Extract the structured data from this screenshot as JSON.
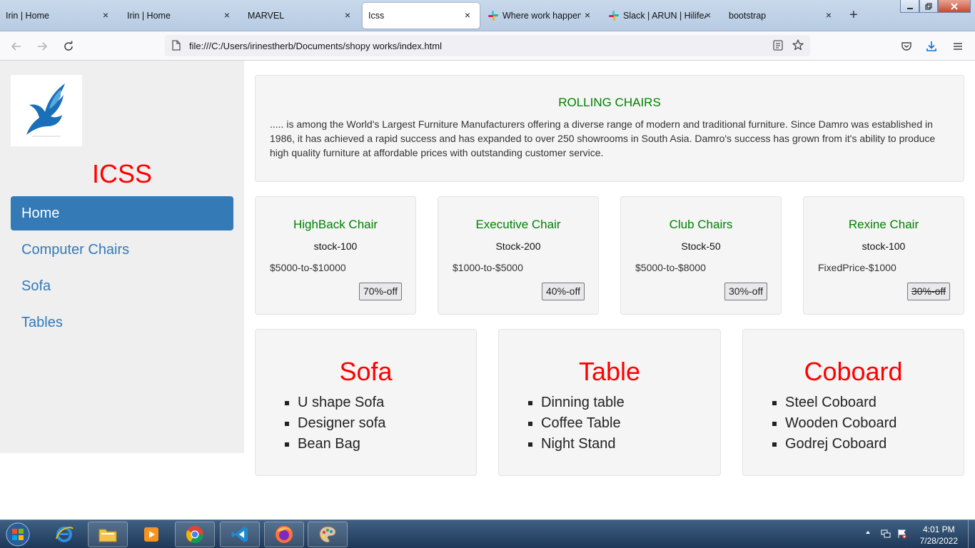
{
  "browser": {
    "tabs": [
      {
        "label": "Irin | Home",
        "active": false,
        "icon": "page-icon"
      },
      {
        "label": "Irin | Home",
        "active": false,
        "icon": "page-icon"
      },
      {
        "label": "MARVEL",
        "active": false,
        "icon": "page-icon"
      },
      {
        "label": "Icss",
        "active": true,
        "icon": "page-icon"
      },
      {
        "label": "Where work happens",
        "active": false,
        "icon": "slack-icon"
      },
      {
        "label": "Slack | ARUN | HilifeA",
        "active": false,
        "icon": "slack-icon"
      },
      {
        "label": "bootstrap",
        "active": false,
        "icon": "page-icon"
      }
    ],
    "tab_close_glyph": "×",
    "new_tab_glyph": "+",
    "url": "file:///C:/Users/irinestherb/Documents/shopy works/index.html"
  },
  "sidebar": {
    "brand": "ICSS",
    "menu": [
      {
        "label": "Home",
        "active": true
      },
      {
        "label": "Computer Chairs",
        "active": false
      },
      {
        "label": "Sofa",
        "active": false
      },
      {
        "label": "Tables",
        "active": false
      }
    ]
  },
  "hero": {
    "title": "ROLLING CHAIRS",
    "text": "..... is among the World's Largest Furniture Manufacturers offering a diverse range of modern and traditional furniture. Since Damro was established in 1986, it has achieved a rapid success and has expanded to over 250 showrooms in South Asia. Damro's success has grown from it's ability to produce high quality furniture at affordable prices with outstanding customer service."
  },
  "products": [
    {
      "name": "HighBack Chair",
      "stock": "stock-100",
      "price": "$5000-to-$10000",
      "discount": "70%-off",
      "struck": false
    },
    {
      "name": "Executive Chair",
      "stock": "Stock-200",
      "price": "$1000-to-$5000",
      "discount": "40%-off",
      "struck": false
    },
    {
      "name": "Club Chairs",
      "stock": "Stock-50",
      "price": "$5000-to-$8000",
      "discount": "30%-off",
      "struck": false
    },
    {
      "name": "Rexine Chair",
      "stock": "stock-100",
      "price": "FixedPrice-$1000",
      "discount": "30%-off",
      "struck": true
    }
  ],
  "categories": [
    {
      "title": "Sofa",
      "items": [
        "U shape Sofa",
        "Designer sofa",
        "Bean Bag"
      ]
    },
    {
      "title": "Table",
      "items": [
        "Dinning table",
        "Coffee Table",
        "Night Stand"
      ]
    },
    {
      "title": "Coboard",
      "items": [
        "Steel Coboard",
        "Wooden Coboard",
        "Godrej Coboard"
      ]
    }
  ],
  "taskbar": {
    "time": "4:01 PM",
    "date": "7/28/2022"
  },
  "colors": {
    "accent_blue": "#337ab7",
    "brand_red": "#ff0000",
    "heading_green": "#008000"
  }
}
